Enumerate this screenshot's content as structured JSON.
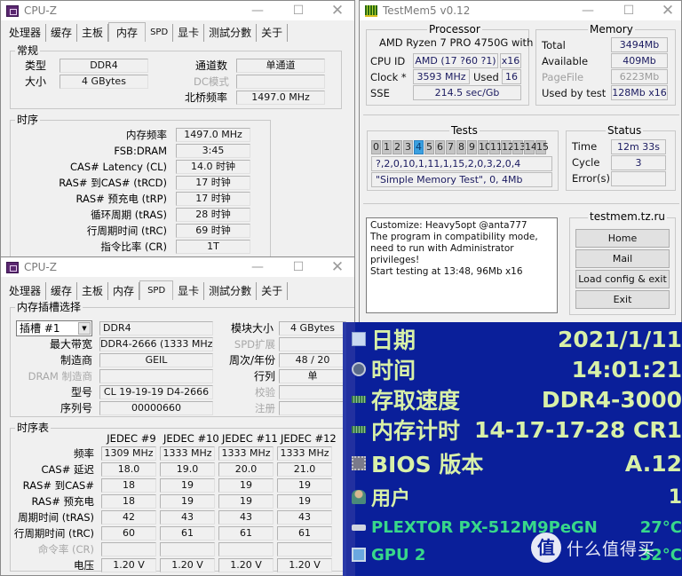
{
  "cpuz_memory": {
    "title": "CPU-Z",
    "tabs": [
      "处理器",
      "缓存",
      "主板",
      "内存",
      "SPD",
      "显卡",
      "测試分數",
      "关于"
    ],
    "active_tab": "内存",
    "general": {
      "title": "常规",
      "type_label": "类型",
      "type_value": "DDR4",
      "size_label": "大小",
      "size_value": "4 GBytes",
      "channels_label": "通道数",
      "channels_value": "单通道",
      "dc_mode_label": "DC模式",
      "dc_mode_value": "",
      "nb_freq_label": "北桥频率",
      "nb_freq_value": "1497.0 MHz"
    },
    "timings": {
      "title": "时序",
      "rows": [
        {
          "label": "内存频率",
          "value": "1497.0 MHz"
        },
        {
          "label": "FSB:DRAM",
          "value": "3:45"
        },
        {
          "label": "CAS# Latency (CL)",
          "value": "14.0 时钟"
        },
        {
          "label": "RAS# 到CAS# (tRCD)",
          "value": "17 时钟"
        },
        {
          "label": "RAS# 预充电 (tRP)",
          "value": "17 时钟"
        },
        {
          "label": "循环周期 (tRAS)",
          "value": "28 时钟"
        },
        {
          "label": "行周期时间 (tRC)",
          "value": "69 时钟"
        },
        {
          "label": "指令比率 (CR)",
          "value": "1T"
        }
      ]
    }
  },
  "cpuz_spd": {
    "title": "CPU-Z",
    "tabs": [
      "处理器",
      "缓存",
      "主板",
      "内存",
      "SPD",
      "显卡",
      "测試分數",
      "关于"
    ],
    "active_tab": "SPD",
    "slot_group_title": "内存插槽选择",
    "slot_select": "插槽 #1",
    "module_type": "DDR4",
    "module_size_label": "模块大小",
    "module_size_value": "4 GBytes",
    "max_bw_label": "最大带宽",
    "max_bw_value": "DDR4-2666 (1333 MHz)",
    "spd_ext_label": "SPD扩展",
    "spd_ext_value": "",
    "manufacturer_label": "制造商",
    "manufacturer_value": "GEIL",
    "week_year_label": "周次/年份",
    "week_year_value": "48 / 20",
    "dram_mfr_label": "DRAM 制造商",
    "dram_mfr_value": "",
    "ranks_label": "行列",
    "ranks_value": "单",
    "part_label": "型号",
    "part_value": "CL 19-19-19 D4-2666",
    "correction_label": "校验",
    "correction_value": "",
    "serial_label": "序列号",
    "serial_value": "00000660",
    "registered_label": "注册",
    "registered_value": "",
    "timing_table": {
      "title": "时序表",
      "columns": [
        "JEDEC #9",
        "JEDEC #10",
        "JEDEC #11",
        "JEDEC #12"
      ],
      "rows": [
        {
          "label": "频率",
          "values": [
            "1309 MHz",
            "1333 MHz",
            "1333 MHz",
            "1333 MHz"
          ],
          "dim": false
        },
        {
          "label": "CAS# 延迟",
          "values": [
            "18.0",
            "19.0",
            "20.0",
            "21.0"
          ],
          "dim": false
        },
        {
          "label": "RAS# 到CAS#",
          "values": [
            "18",
            "19",
            "19",
            "19"
          ],
          "dim": false
        },
        {
          "label": "RAS# 预充电",
          "values": [
            "18",
            "19",
            "19",
            "19"
          ],
          "dim": false
        },
        {
          "label": "周期时间 (tRAS)",
          "values": [
            "42",
            "43",
            "43",
            "43"
          ],
          "dim": false
        },
        {
          "label": "行周期时间 (tRC)",
          "values": [
            "60",
            "61",
            "61",
            "61"
          ],
          "dim": false
        },
        {
          "label": "命令率 (CR)",
          "values": [
            "",
            "",
            "",
            ""
          ],
          "dim": true
        },
        {
          "label": "电压",
          "values": [
            "1.20 V",
            "1.20 V",
            "1.20 V",
            "1.20 V"
          ],
          "dim": false
        }
      ]
    }
  },
  "testmem": {
    "title": "TestMem5 v0.12",
    "processor": {
      "title": "Processor",
      "name": "AMD Ryzen 7 PRO 4750G with",
      "cpu_id_label": "CPU ID",
      "cpu_id_value": "AMD  (17 ?60 ?1)",
      "threads": "x16",
      "clock_label": "Clock *",
      "clock_value": "3593 MHz",
      "used_label": "Used",
      "used_value": "16",
      "sse_label": "SSE",
      "sse_value": "214.5 sec/Gb"
    },
    "memory": {
      "title": "Memory",
      "total_label": "Total",
      "total_value": "3494Mb",
      "available_label": "Available",
      "available_value": "409Mb",
      "pagefile_label": "PageFile",
      "pagefile_value": "6223Mb",
      "used_by_test_label": "Used by test",
      "used_by_test_value": "128Mb x16"
    },
    "tests": {
      "title": "Tests",
      "cells": [
        "0",
        "1",
        "2",
        "3",
        "4",
        "5",
        "6",
        "7",
        "8",
        "9",
        "10",
        "11",
        "12",
        "13",
        "14",
        "15"
      ],
      "active_index": 4,
      "sequence": "?,2,0,10,1,11,1,15,2,0,3,2,0,4",
      "current": "\"Simple Memory Test\", 0, 4Mb"
    },
    "status": {
      "title": "Status",
      "time_label": "Time",
      "time_value": "12m 33s",
      "cycle_label": "Cycle",
      "cycle_value": "3",
      "errors_label": "Error(s)",
      "errors_value": ""
    },
    "log": [
      "Customize: Heavy5opt @anta777",
      "The program in compatibility mode,",
      "need to run with Administrator privileges!",
      "Start testing at 13:48, 96Mb x16"
    ],
    "site": {
      "title": "testmem.tz.ru",
      "buttons": [
        "Home",
        "Mail",
        "Load config & exit",
        "Exit"
      ]
    }
  },
  "aida_overlay": {
    "rows": [
      {
        "icon": "calendar-icon",
        "label": "日期",
        "value": "2021/1/11"
      },
      {
        "icon": "clock-icon",
        "label": "时间",
        "value": "14:01:21"
      },
      {
        "icon": "memory-module-icon",
        "label": "存取速度",
        "value": "DDR4-3000"
      },
      {
        "icon": "memory-module-icon",
        "label": "内存计时",
        "value": "14-17-17-28 CR1"
      },
      {
        "icon": "chip-icon",
        "label": "BIOS 版本",
        "value": "A.12"
      },
      {
        "icon": "user-icon",
        "label": "用户",
        "value": "1"
      },
      {
        "icon": "drive-icon",
        "label": "PLEXTOR PX-512M9PeGN",
        "value": "27°C"
      },
      {
        "icon": "monitor-icon",
        "label": "GPU 2",
        "value": "32°C"
      }
    ]
  },
  "watermark": {
    "badge": "值",
    "text": "什么值得买"
  }
}
